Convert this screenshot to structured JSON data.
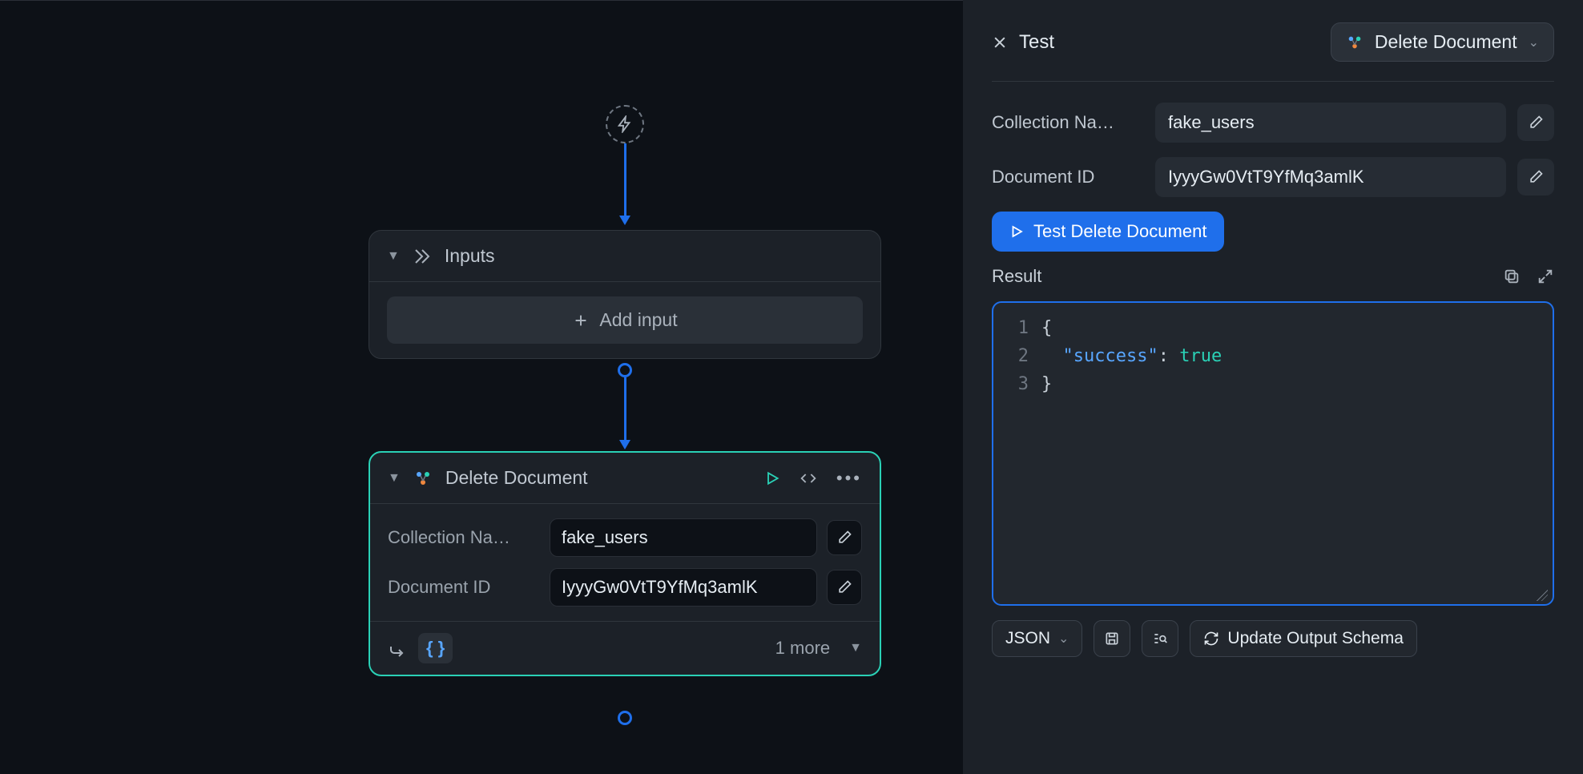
{
  "canvas": {
    "inputs_node": {
      "title": "Inputs",
      "add_label": "Add input"
    },
    "delete_node": {
      "title": "Delete Document",
      "fields": {
        "collection_label": "Collection Na…",
        "collection_value": "fake_users",
        "docid_label": "Document ID",
        "docid_value": "IyyyGw0VtT9YfMq3amlK"
      },
      "footer": {
        "more_label": "1 more"
      }
    }
  },
  "panel": {
    "title": "Test",
    "selector_label": "Delete Document",
    "fields": {
      "collection_label": "Collection Na…",
      "collection_value": "fake_users",
      "docid_label": "Document ID",
      "docid_value": "IyyyGw0VtT9YfMq3amlK"
    },
    "test_button": "Test Delete Document",
    "result_label": "Result",
    "result_json": {
      "key": "\"success\"",
      "value": "true"
    },
    "footer": {
      "format": "JSON",
      "update_schema": "Update Output Schema"
    }
  }
}
